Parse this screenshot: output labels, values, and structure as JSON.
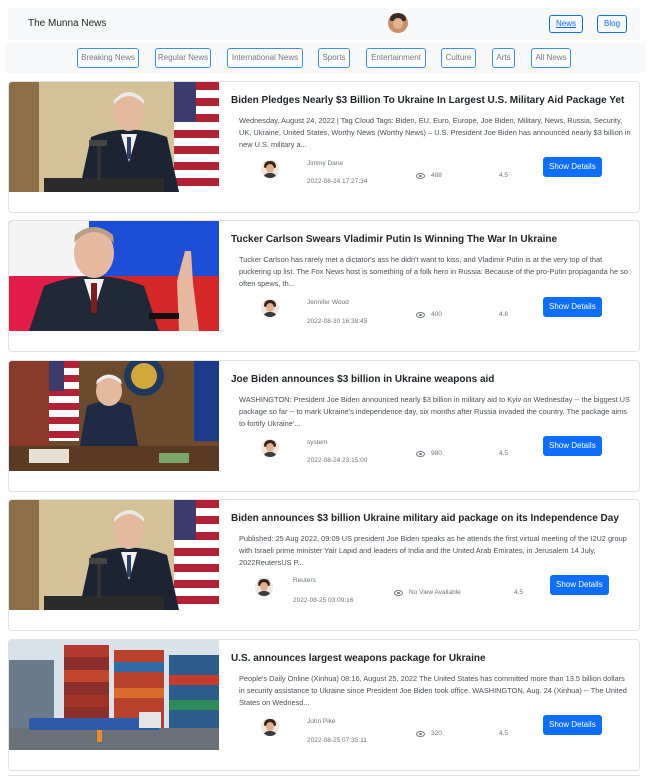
{
  "header": {
    "brand": "The Munna News",
    "news_label": "News",
    "blog_label": "Blog"
  },
  "categories": [
    "Breaking News",
    "Regular News",
    "International News",
    "Sports",
    "Entertainment",
    "Culture",
    "Arts",
    "All News"
  ],
  "articles": [
    {
      "title": "Biden Pledges Nearly $3 Billion To Ukraine In Largest U.S. Military Aid Package Yet",
      "excerpt": "Wednesday, August 24, 2022 | Tag Cloud Tags: Biden, EU, Euro, Europe, Joe Biden, Military, News, Russia, Security, UK, Ukraine, United States, Worthy News (Worthy News) – U.S. President Joe Biden has announced nearly $3 billion in new U.S. military a...",
      "author": "Jimmy Dane",
      "date": "2022-08-24 17:27:34",
      "views": "488",
      "rating": "4.5",
      "button": "Show Details",
      "image_icon": "biden-podium-photo"
    },
    {
      "title": "Tucker Carlson Swears Vladimir Putin Is Winning The War In Ukraine",
      "excerpt": "Tucker Carlson has rarely met a dictator's ass he didn't want to kiss, and Vladimir Putin is at the very top of that puckering up list. The Fox News host is something of a folk hero in Russia: Because of the pro-Putin propaganda he so often spews, th...",
      "author": "Jennifer Wood",
      "date": "2022-08-30 16:38:45",
      "views": "400",
      "rating": "4.8",
      "button": "Show Details",
      "image_icon": "putin-speaking-photo"
    },
    {
      "title": "Joe Biden announces $3 billion in Ukraine weapons aid",
      "excerpt": "WASHINGTON: President Joe Biden announced nearly $3 billion in military aid to Kyiv on Wednesday -- the biggest US package so far -- to mark Ukraine's independence day, six months after Russia invaded the country. The package aims to fortify Ukraine'...",
      "author": "system",
      "date": "2022-08-24 23:15:00",
      "views": "980",
      "rating": "4.5",
      "button": "Show Details",
      "image_icon": "biden-desk-photo"
    },
    {
      "title": "Biden announces $3 billion Ukraine military aid package on its Independence Day",
      "excerpt": "Published: 25 Aug 2022, 09:09 US president Joe Biden speaks as he attends the first virtual meeting of the I2U2 group with Israeli prime minister Yair Lapid and leaders of India and the United Arab Emirates, in Jerusalem 14 July, 2022ReutersUS P...",
      "author": "Reuters",
      "date": "2022-08-25 03:09:16",
      "views": "No View Available",
      "rating": "4.5",
      "button": "Show Details",
      "image_icon": "biden-podium-photo"
    },
    {
      "title": "U.S. announces largest weapons package for Ukraine",
      "excerpt": "People's Daily Online (Xinhua) 08:16, August 25, 2022 The United States has committed more than 13.5 billion dollars in security assistance to Ukraine since President Joe Biden took office. WASHINGTON, Aug. 24 (Xinhua) -- The United States on Wednesd...",
      "author": "John Pike",
      "date": "2022-08-25 07:35:11",
      "views": "320",
      "rating": "4.5",
      "button": "Show Details",
      "image_icon": "cargo-port-photo"
    }
  ]
}
